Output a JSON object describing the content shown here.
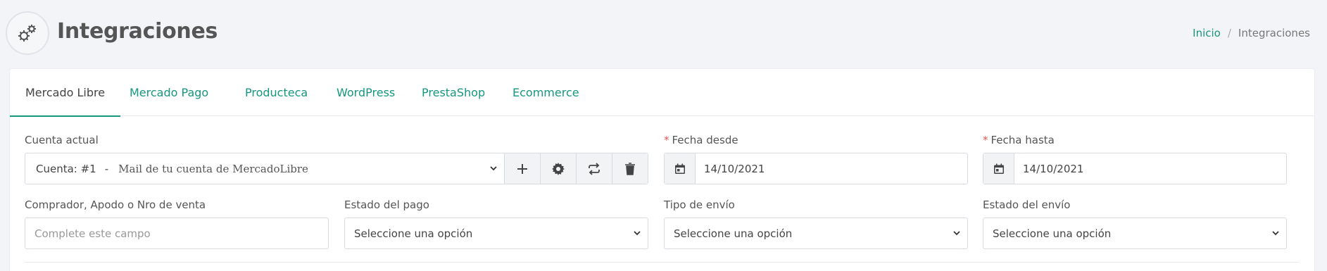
{
  "header": {
    "title": "Integraciones",
    "icon": "gears-icon",
    "breadcrumb": {
      "home": "Inicio",
      "separator": "/",
      "current": "Integraciones"
    }
  },
  "tabs": [
    {
      "label": "Mercado Libre",
      "active": true
    },
    {
      "label": "Mercado Pago",
      "active": false
    },
    {
      "label": "Producteca",
      "active": false
    },
    {
      "label": "WordPress",
      "active": false
    },
    {
      "label": "PrestaShop",
      "active": false
    },
    {
      "label": "Ecommerce",
      "active": false
    }
  ],
  "filters": {
    "account": {
      "label": "Cuenta actual",
      "value": "Cuenta: #1",
      "dash": "-",
      "email_placeholder": "Mail de tu cuenta de MercadoLibre"
    },
    "date_from": {
      "label": "Fecha desde",
      "required_mark": "*",
      "value": "14/10/2021"
    },
    "date_to": {
      "label": "Fecha hasta",
      "required_mark": "*",
      "value": "14/10/2021"
    },
    "buyer": {
      "label": "Comprador, Apodo o Nro de venta",
      "placeholder": "Complete este campo"
    },
    "payment_status": {
      "label": "Estado del pago",
      "value": "Seleccione una opción"
    },
    "shipping_type": {
      "label": "Tipo de envío",
      "value": "Seleccione una opción"
    },
    "shipping_status": {
      "label": "Estado del envío",
      "value": "Seleccione una opción"
    }
  },
  "colors": {
    "accent": "#16967e",
    "required": "#e05a5a",
    "background": "#f3f4f7"
  }
}
